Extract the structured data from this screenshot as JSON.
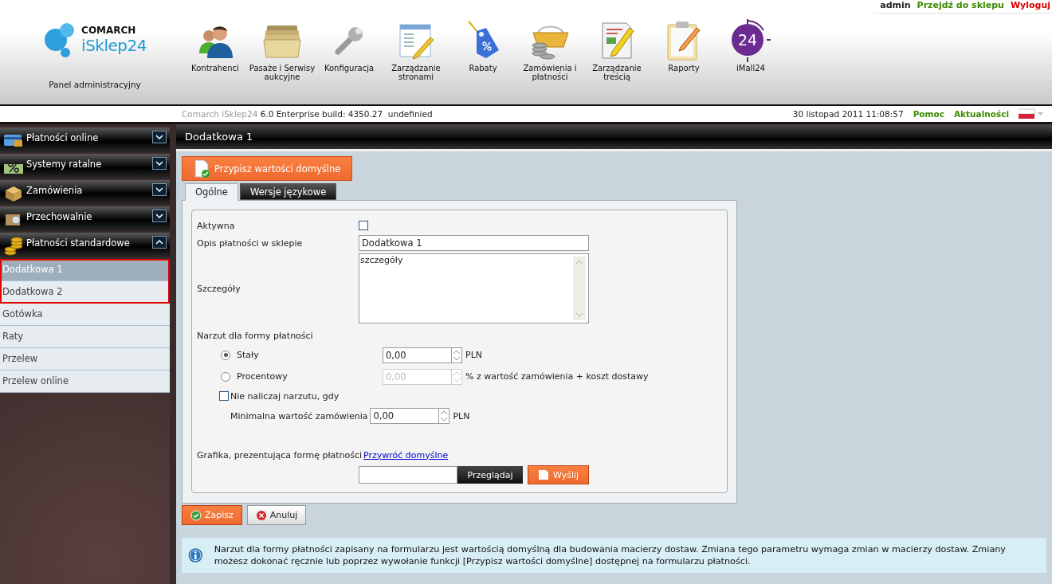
{
  "header": {
    "logo": {
      "brand": "COMARCH",
      "product": "iSklep24",
      "caption": "Panel administracyjny"
    },
    "nav": [
      {
        "label": "Kontrahenci"
      },
      {
        "label": "Pasaże i Serwisy aukcyjne"
      },
      {
        "label": "Konfiguracja"
      },
      {
        "label": "Zarządzanie stronami"
      },
      {
        "label": "Rabaty"
      },
      {
        "label": "Zamówienia i płatności"
      },
      {
        "label": "Zarządzanie treścią"
      },
      {
        "label": "Raporty"
      },
      {
        "label": "iMall24",
        "badge_text": "24"
      }
    ],
    "user": "admin",
    "links": [
      {
        "label": "Przejdź do sklepu",
        "kind": "shop"
      },
      {
        "label": "Wyloguj",
        "kind": "logout"
      }
    ]
  },
  "status_bar": {
    "product": "Comarch iSklep24",
    "version": "6.0 Enterprise build: 4350.27  undefinied",
    "datetime": "30 listopad 2011 11:08:57",
    "links": [
      "Pomoc",
      "Aktualności"
    ]
  },
  "sidebar": {
    "sections": [
      {
        "label": "Płatności online",
        "expanded": false
      },
      {
        "label": "Systemy ratalne",
        "expanded": false
      },
      {
        "label": "Zamówienia",
        "expanded": false
      },
      {
        "label": "Przechowalnie",
        "expanded": false
      },
      {
        "label": "Płatności standardowe",
        "expanded": true
      }
    ],
    "items": [
      {
        "label": "Dodatkowa 1",
        "selected": true,
        "marked": true
      },
      {
        "label": "Dodatkowa 2",
        "selected": false,
        "marked": true
      },
      {
        "label": "Gotówka",
        "selected": false,
        "marked": false
      },
      {
        "label": "Raty",
        "selected": false,
        "marked": false
      },
      {
        "label": "Przelew",
        "selected": false,
        "marked": false
      },
      {
        "label": "Przelew online",
        "selected": false,
        "marked": false
      }
    ]
  },
  "main": {
    "title": "Dodatkowa 1",
    "action_button": "Przypisz wartości domyślne",
    "tabs": [
      {
        "label": "Ogólne",
        "selected": true
      },
      {
        "label": "Wersje językowe",
        "selected": false
      }
    ],
    "form": {
      "active": {
        "label": "Aktywna",
        "checked": false
      },
      "description": {
        "label": "Opis płatności w sklepie",
        "value": "Dodatkowa 1"
      },
      "details": {
        "label": "Szczegóły",
        "value": "szczegóły"
      },
      "surcharge": {
        "heading": "Narzut dla formy płatności",
        "options": [
          {
            "label": "Stały",
            "selected": true,
            "value": "0,00",
            "unit": "PLN",
            "disabled": false
          },
          {
            "label": "Procentowy",
            "selected": false,
            "value": "0,00",
            "unit": "% z wartość zamówienia + koszt dostawy",
            "disabled": true
          }
        ]
      },
      "no_surcharge": {
        "label": "Nie naliczaj narzutu, gdy",
        "checked": false,
        "min_label": "Minimalna wartość zamówienia",
        "value": "0,00",
        "unit": "PLN"
      },
      "graphic": {
        "label": "Grafika, prezentująca formę płatności",
        "link": "Przywróć domyślne",
        "browse": "Przeglądaj",
        "send": "Wyślij"
      }
    },
    "buttons": [
      {
        "label": "Zapisz",
        "kind": "save"
      },
      {
        "label": "Anuluj",
        "kind": "cancel"
      }
    ],
    "info": "Narzut dla formy płatności zapisany na formularzu jest wartością domyślną dla budowania macierzy dostaw. Zmiana tego parametru wymaga zmian w macierzy dostaw. Zmiany możesz dokonać ręcznie lub poprzez wywołanie funkcji [Przypisz wartości domyślne] dostępnej na formularzu płatności."
  }
}
